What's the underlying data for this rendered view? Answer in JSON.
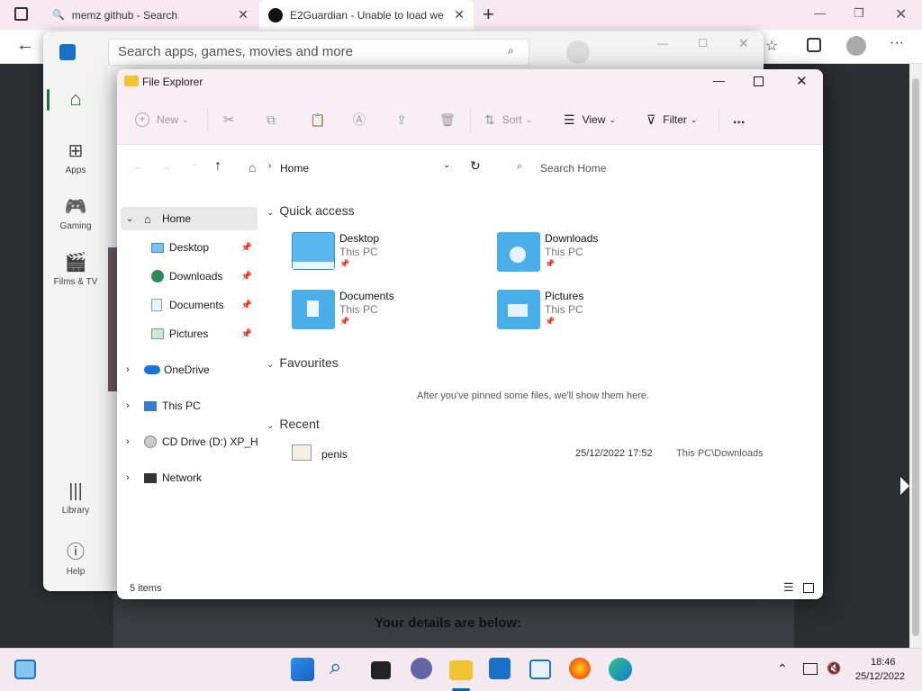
{
  "browser": {
    "tabs": [
      {
        "label": "memz github - Search"
      },
      {
        "label": "E2Guardian - Unable to load we"
      }
    ],
    "new_tab": "+",
    "page_footer_text": "Your details are below:"
  },
  "store": {
    "search_placeholder": "Search apps, games, movies and more",
    "nav": [
      {
        "label": "Apps"
      },
      {
        "label": "Gaming"
      },
      {
        "label": "Films & TV"
      },
      {
        "label": "Library"
      },
      {
        "label": "Help"
      }
    ]
  },
  "explorer": {
    "title": "File Explorer",
    "toolbar": {
      "new": "New",
      "sort": "Sort",
      "view": "View",
      "filter": "Filter",
      "more": "..."
    },
    "address": {
      "location": "Home",
      "search_placeholder": "Search Home"
    },
    "sidebar": [
      {
        "label": "Home"
      },
      {
        "label": "Desktop"
      },
      {
        "label": "Downloads"
      },
      {
        "label": "Documents"
      },
      {
        "label": "Pictures"
      },
      {
        "label": "OneDrive"
      },
      {
        "label": "This PC"
      },
      {
        "label": "CD Drive (D:) XP_HO"
      },
      {
        "label": "Network"
      }
    ],
    "quick_access": {
      "heading": "Quick access",
      "tiles": [
        {
          "name": "Desktop",
          "sub": "This PC"
        },
        {
          "name": "Downloads",
          "sub": "This PC"
        },
        {
          "name": "Documents",
          "sub": "This PC"
        },
        {
          "name": "Pictures",
          "sub": "This PC"
        }
      ]
    },
    "favourites": {
      "heading": "Favourites",
      "empty": "After you've pinned some files, we'll show them here."
    },
    "recent": {
      "heading": "Recent",
      "items": [
        {
          "name": "penis",
          "date": "25/12/2022 17:52",
          "location": "This PC\\Downloads"
        }
      ]
    },
    "status": "5 items"
  },
  "taskbar": {
    "time": "18:46",
    "date": "25/12/2022"
  },
  "colors": {
    "folder": "#4aaee8",
    "folder_dark": "#2f8fd0",
    "accent": "#0067c0"
  }
}
